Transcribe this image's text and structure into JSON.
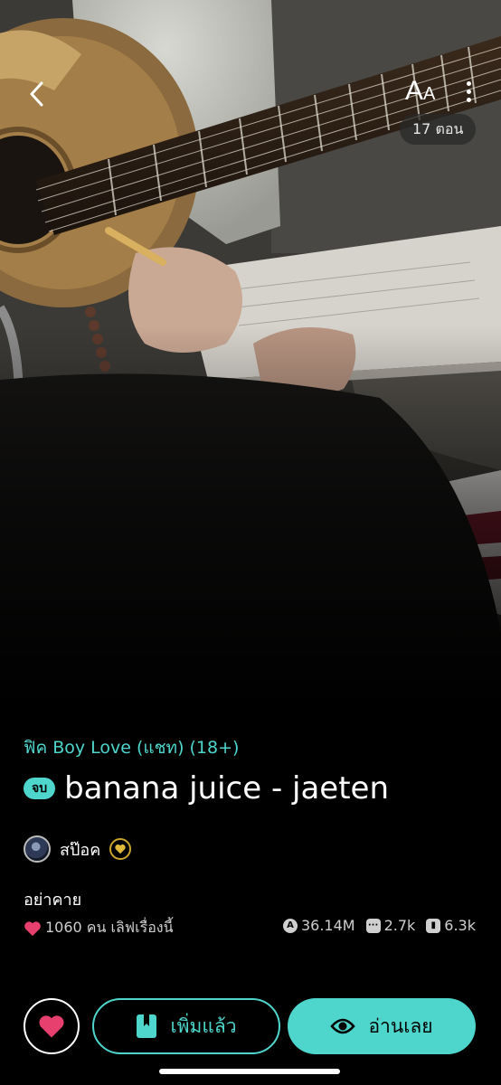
{
  "header": {
    "font_button_big": "A",
    "font_button_small": "A",
    "episodes_label": "17 ตอน"
  },
  "story": {
    "category": "ฟิค Boy Love (แชท) (18+)",
    "status_badge": "จบ",
    "title": "banana juice - jaeten",
    "author": "สป๊อค",
    "tag_text": "อย่าคาย",
    "likes_text": "1060 คน เลิฟเรื่องนี้",
    "stats": {
      "views": "36.14M",
      "comments": "2.7k",
      "library": "6.3k"
    }
  },
  "actions": {
    "library_label": "เพิ่มแล้ว",
    "read_label": "อ่านเลย"
  },
  "colors": {
    "accent": "#4fd6cc",
    "heart": "#e8406e",
    "background": "#000000"
  },
  "icons": {
    "back": "chevron-left-icon",
    "font": "font-size-icon",
    "more": "more-vertical-icon",
    "heart": "heart-icon",
    "views": "views-icon",
    "comments": "comment-icon",
    "library": "book-icon",
    "eye": "eye-icon"
  }
}
